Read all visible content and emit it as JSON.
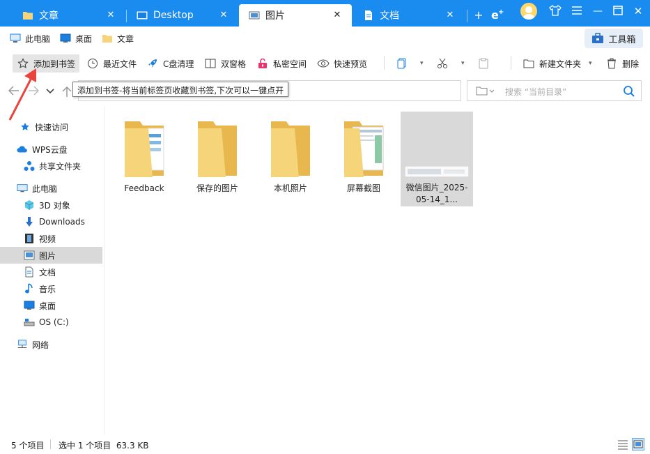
{
  "tabs": [
    {
      "label": "文章",
      "icon": "folder-icon"
    },
    {
      "label": "Desktop",
      "icon": "desktop-icon"
    },
    {
      "label": "图片",
      "icon": "pictures-icon"
    },
    {
      "label": "文档",
      "icon": "document-icon"
    }
  ],
  "tabbar_buttons": {
    "new_tab": "+",
    "minimize": "—",
    "close": "✕"
  },
  "bookmarks": [
    {
      "label": "此电脑",
      "icon": "computer-icon"
    },
    {
      "label": "桌面",
      "icon": "desktop-icon"
    },
    {
      "label": "文章",
      "icon": "folder-icon"
    }
  ],
  "toolbox_label": "工具箱",
  "toolbar": {
    "add_bookmark": "添加到书签",
    "recent_files": "最近文件",
    "c_clean": "C盘清理",
    "dual_pane": "双窗格",
    "private_space": "私密空间",
    "quick_preview": "快速预览",
    "new_folder": "新建文件夹",
    "delete": "删除"
  },
  "tooltip_text": "添加到书签-将当前标签页收藏到书签,下次可以一键点开",
  "search": {
    "placeholder": "搜索 “当前目录”"
  },
  "sidebar": {
    "quick_access": "快速访问",
    "wps_cloud": "WPS云盘",
    "shared_folder": "共享文件夹",
    "this_pc": "此电脑",
    "objects_3d": "3D 对象",
    "downloads": "Downloads",
    "videos": "视频",
    "pictures": "图片",
    "documents": "文档",
    "music": "音乐",
    "desktop": "桌面",
    "os_drive": "OS (C:)",
    "network": "网络"
  },
  "files": [
    {
      "name": "Feedback",
      "type": "folder"
    },
    {
      "name": "保存的图片",
      "type": "folder"
    },
    {
      "name": "本机照片",
      "type": "folder"
    },
    {
      "name": "屏幕截图",
      "type": "folder"
    },
    {
      "name": "微信图片_2025-05-14_1...",
      "type": "image"
    }
  ],
  "status": {
    "item_count": "5 个项目",
    "selection": "选中 1 个项目  63.3 KB"
  },
  "colors": {
    "tabbar_blue": "#1a8cf0",
    "folder_yellow": "#f5d47a",
    "accent_blue": "#1a7fe0",
    "annotation_red": "#e8453c"
  }
}
